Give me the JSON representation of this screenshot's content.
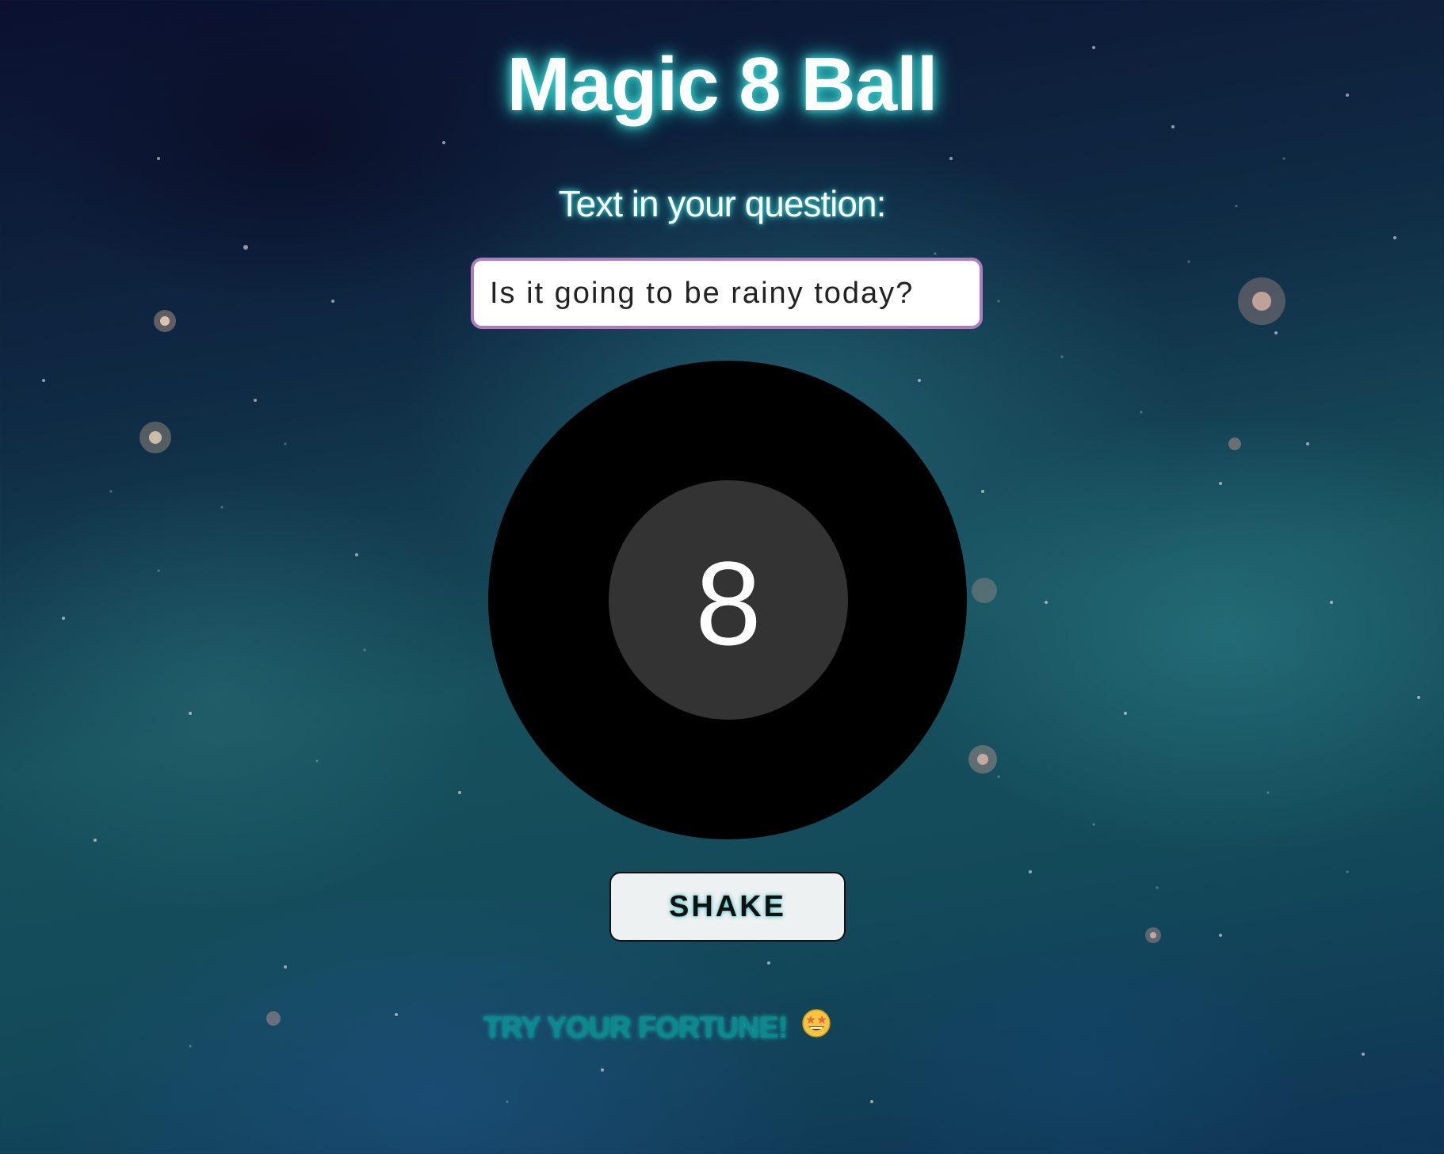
{
  "page": {
    "title": "Magic 8 Ball",
    "prompt_label": "Text in your question:"
  },
  "question": {
    "value": "Is it going to be rainy today?"
  },
  "ball": {
    "number": "8"
  },
  "shake_button": {
    "label": "SHAKE"
  },
  "tagline": {
    "text": "TRY YOUR FORTUNE!",
    "icon": "star-struck-emoji-icon"
  },
  "colors": {
    "title_glow": "#3fd4d4",
    "input_border": "#b07cc0",
    "ball": "#000000",
    "ball_inner": "#333333",
    "tagline": "#0a8a8c",
    "button_bg": "#eef1f2"
  }
}
